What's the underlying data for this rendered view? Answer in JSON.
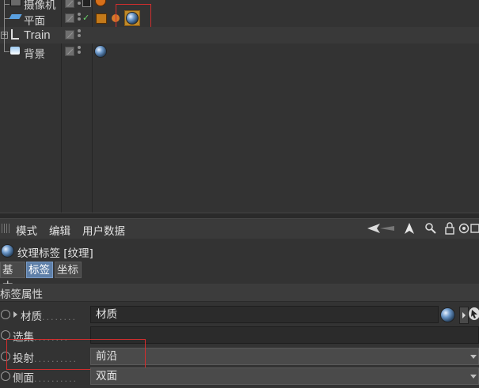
{
  "object_manager": {
    "objects": [
      {
        "name": "摄像机"
      },
      {
        "name": "平面"
      },
      {
        "name": "Train"
      },
      {
        "name": "背景"
      }
    ]
  },
  "attribute_manager": {
    "menu": [
      "模式",
      "编辑",
      "用户数据"
    ],
    "title": "纹理标签 [纹理]",
    "tabs": [
      "基本",
      "标签",
      "坐标"
    ],
    "active_tab": "标签",
    "section_title": "标签属性",
    "properties": [
      {
        "label": "材质",
        "leader": "........",
        "value": "材质"
      },
      {
        "label": "选集",
        "leader": "........",
        "value": ""
      },
      {
        "label": "投射",
        "leader": "..........",
        "value": "前沿"
      },
      {
        "label": "侧面",
        "leader": "..........",
        "value": "双面"
      }
    ]
  },
  "colors": {
    "accent_tab": "#5e7fa8",
    "highlight_box": "#d12e2e",
    "check": "#6bd36b"
  },
  "icons": [
    "camera-icon",
    "plane-icon",
    "null-icon",
    "background-icon",
    "texture-tag-icon",
    "back-arrow-icon",
    "cursor-icon",
    "search-icon",
    "lock-icon",
    "target-icon",
    "new-window-icon"
  ]
}
